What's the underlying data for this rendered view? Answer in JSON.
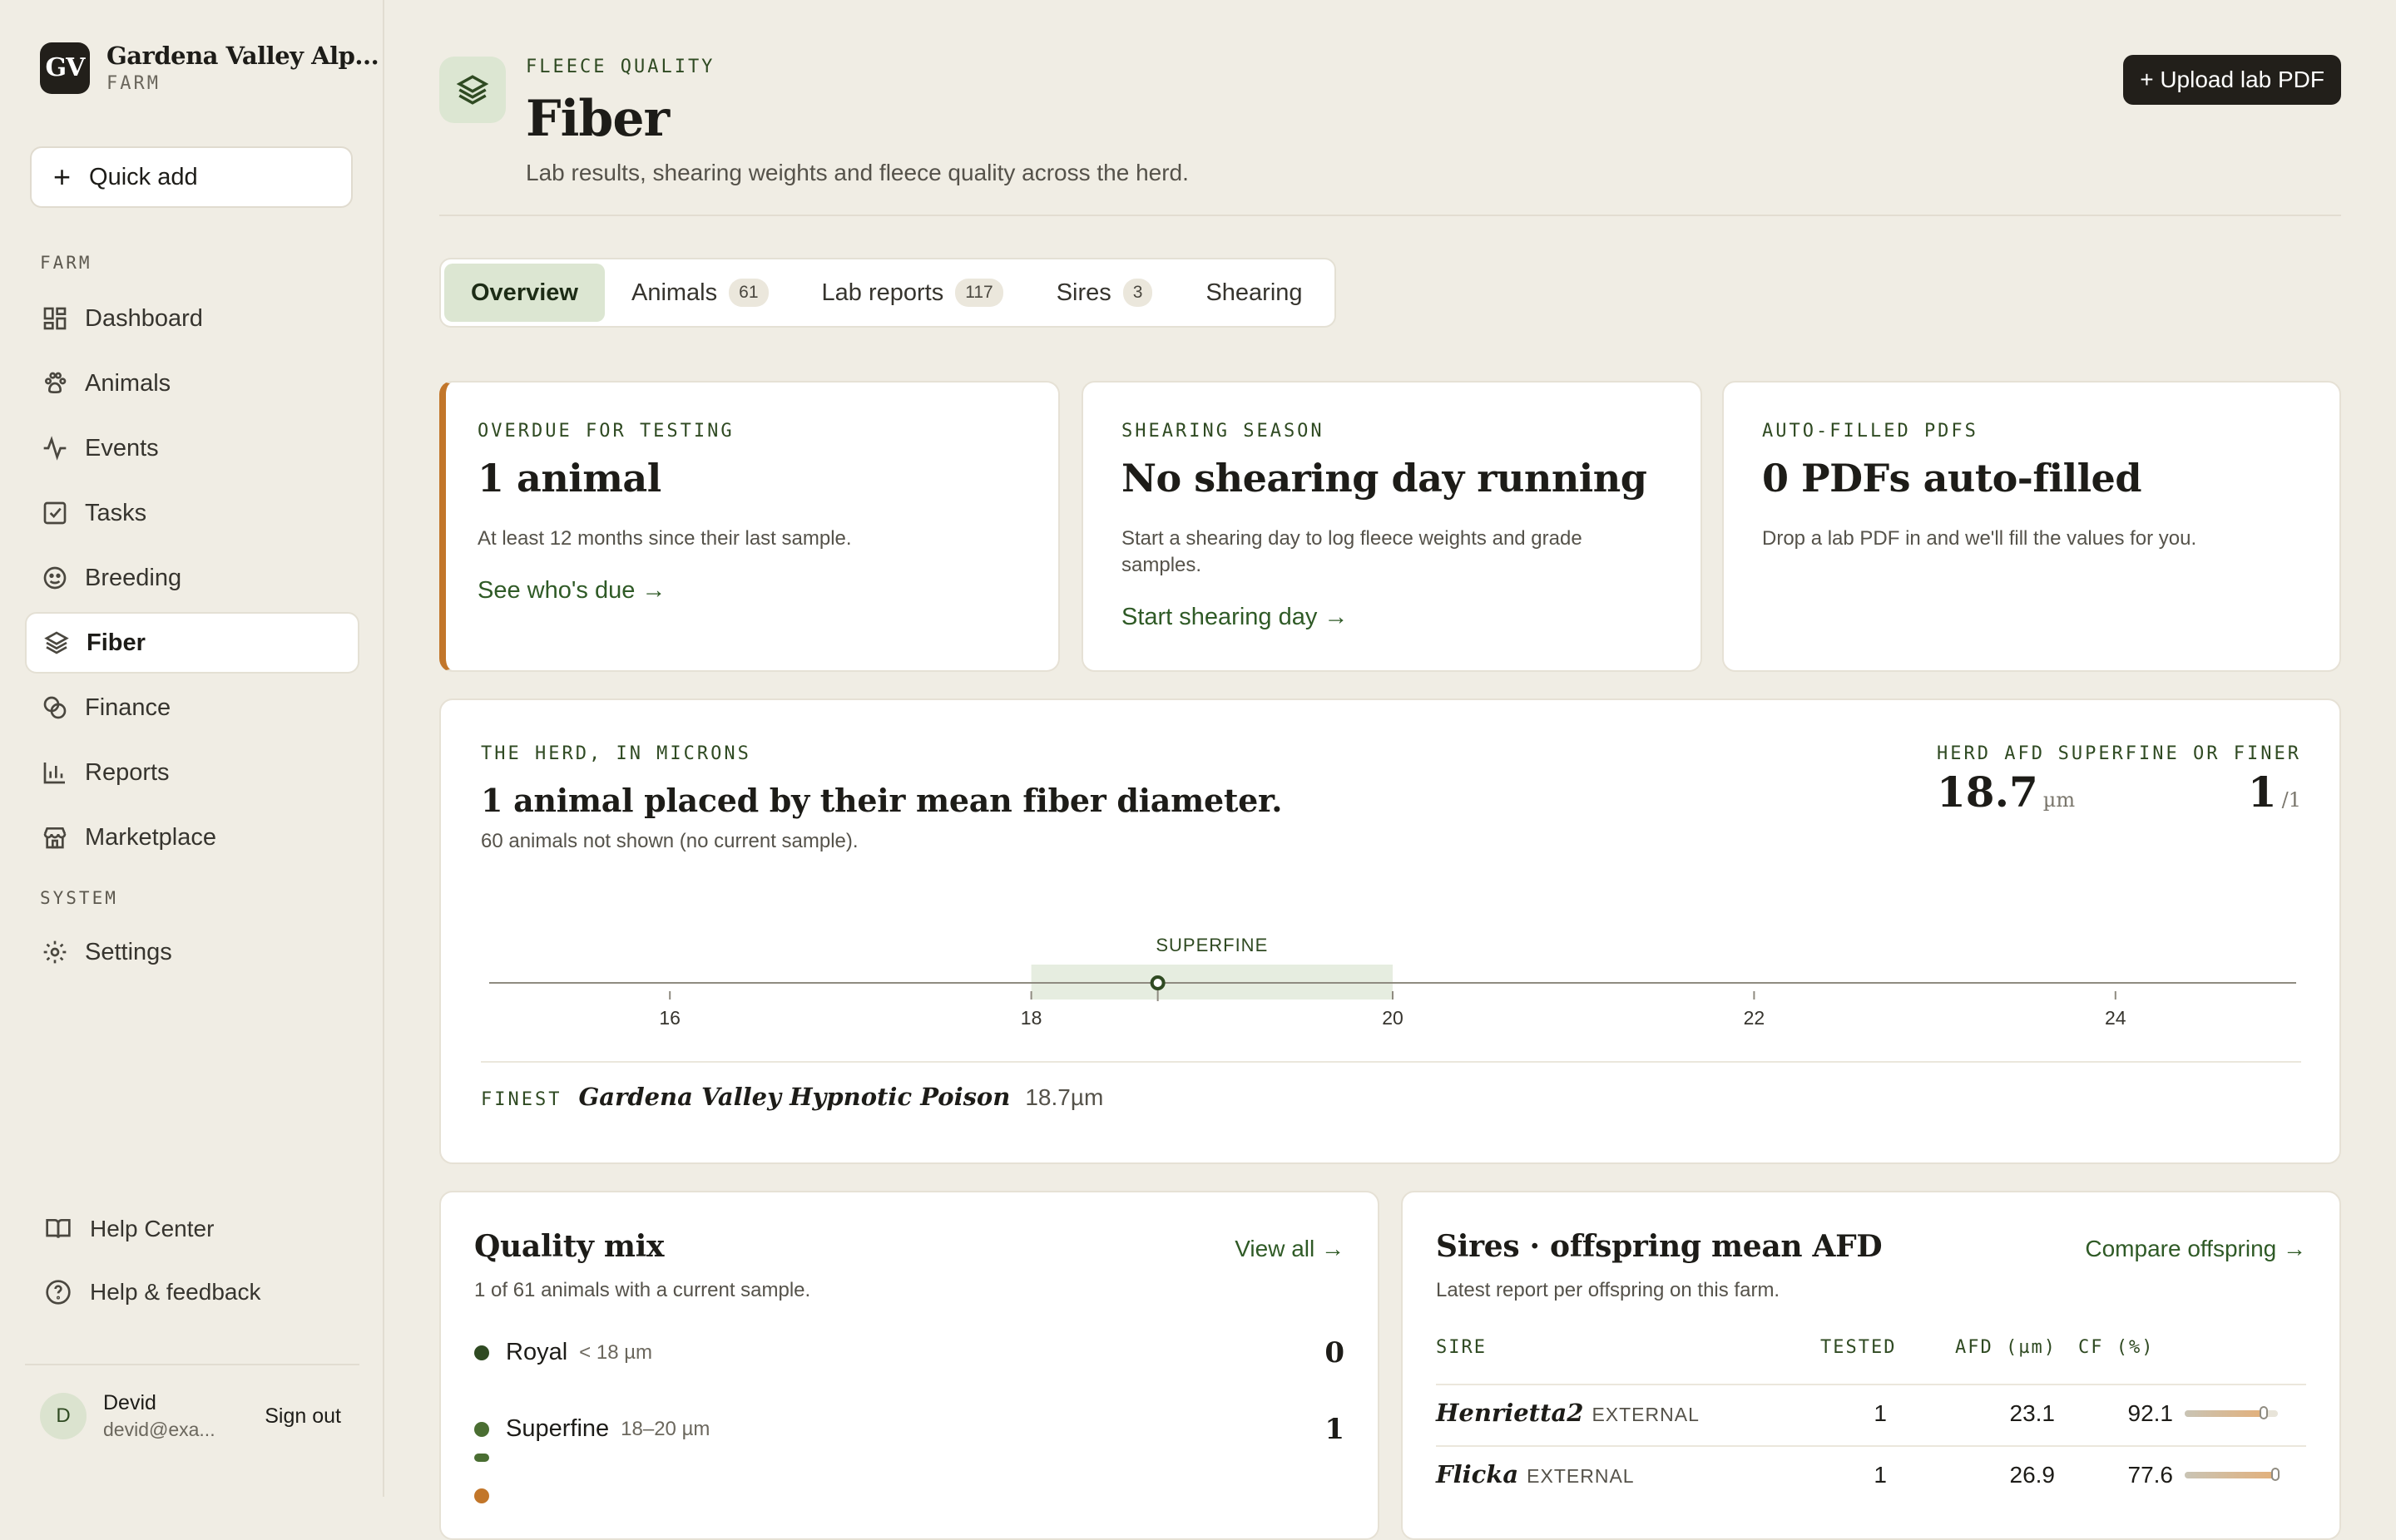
{
  "brand": {
    "logo": "GV",
    "name": "Gardena Valley Alp...",
    "sub": "FARM"
  },
  "sidebar": {
    "quick_add": "Quick add",
    "section_farm": "FARM",
    "section_system": "SYSTEM",
    "items": [
      {
        "label": "Dashboard",
        "icon": "dashboard-icon"
      },
      {
        "label": "Animals",
        "icon": "paw-icon"
      },
      {
        "label": "Events",
        "icon": "activity-icon"
      },
      {
        "label": "Tasks",
        "icon": "checkbox-icon"
      },
      {
        "label": "Breeding",
        "icon": "breeding-icon"
      },
      {
        "label": "Fiber",
        "icon": "layers-icon"
      },
      {
        "label": "Finance",
        "icon": "coins-icon"
      },
      {
        "label": "Reports",
        "icon": "bar-chart-icon"
      },
      {
        "label": "Marketplace",
        "icon": "store-icon"
      }
    ],
    "settings": "Settings",
    "help_center": "Help Center",
    "help_feedback": "Help & feedback",
    "user": {
      "initial": "D",
      "name": "Devid",
      "email": "devid@exa...",
      "sign_out": "Sign out"
    }
  },
  "header": {
    "eyebrow": "FLEECE QUALITY",
    "title": "Fiber",
    "subtitle": "Lab results, shearing weights and fleece quality across the herd.",
    "upload": "+ Upload lab PDF"
  },
  "tabs": [
    {
      "label": "Overview",
      "count": ""
    },
    {
      "label": "Animals",
      "count": "61"
    },
    {
      "label": "Lab reports",
      "count": "117"
    },
    {
      "label": "Sires",
      "count": "3"
    },
    {
      "label": "Shearing",
      "count": ""
    }
  ],
  "cards": {
    "overdue": {
      "eyebrow": "OVERDUE FOR TESTING",
      "title": "1 animal",
      "desc": "At least 12 months since their last sample.",
      "link": "See who's due →"
    },
    "shearing": {
      "eyebrow": "SHEARING SEASON",
      "title": "No shearing day running",
      "desc": "Start a shearing day to log fleece weights and grade samples.",
      "link": "Start shearing day →"
    },
    "autofill": {
      "eyebrow": "AUTO-FILLED PDFS",
      "title": "0 PDFs auto-filled",
      "desc": "Drop a lab PDF in and we'll fill the values for you."
    }
  },
  "herd": {
    "eyebrow": "THE HERD, IN MICRONS",
    "title": "1 animal placed by their mean fiber diameter.",
    "subtitle": "60 animals not shown (no current sample).",
    "afd_label": "HERD AFD",
    "afd_value": "18.7",
    "afd_unit": "µm",
    "superfine_label": "SUPERFINE OR FINER",
    "superfine_value": "1",
    "superfine_total": "/1",
    "band_label": "SUPERFINE",
    "finest_label": "FINEST",
    "finest_name": "Gardena Valley Hypnotic Poison",
    "finest_value": "18.7µm"
  },
  "chart_data": {
    "type": "scatter",
    "xlim": [
      15,
      25
    ],
    "ticks": [
      16,
      18,
      20,
      22,
      24
    ],
    "bands": [
      {
        "label": "SUPERFINE",
        "from": 18,
        "to": 20
      }
    ],
    "points": [
      {
        "name": "Poison",
        "x": 18.7,
        "label": "18.7"
      }
    ]
  },
  "quality_mix": {
    "title": "Quality mix",
    "subtitle": "1 of 61 animals with a current sample.",
    "link": "View all →",
    "rows": [
      {
        "name": "Royal",
        "range": "< 18 µm",
        "count": "0",
        "color": "#2f4a22"
      },
      {
        "name": "Superfine",
        "range": "18–20 µm",
        "count": "1",
        "color": "#4a6e32"
      }
    ]
  },
  "sires": {
    "title": "Sires · offspring mean AFD",
    "subtitle": "Latest report per offspring on this farm.",
    "link": "Compare offspring →",
    "headers": {
      "sire": "SIRE",
      "tested": "TESTED",
      "afd": "AFD (µm)",
      "cf": "CF (%)"
    },
    "rows": [
      {
        "name": "Henrietta2",
        "tag": "EXTERNAL",
        "tested": "1",
        "afd": "23.1",
        "cf": "92.1",
        "cf_fraction": 0.85
      },
      {
        "name": "Flicka",
        "tag": "EXTERNAL",
        "tested": "1",
        "afd": "26.9",
        "cf": "77.6",
        "cf_fraction": 0.97
      }
    ]
  }
}
